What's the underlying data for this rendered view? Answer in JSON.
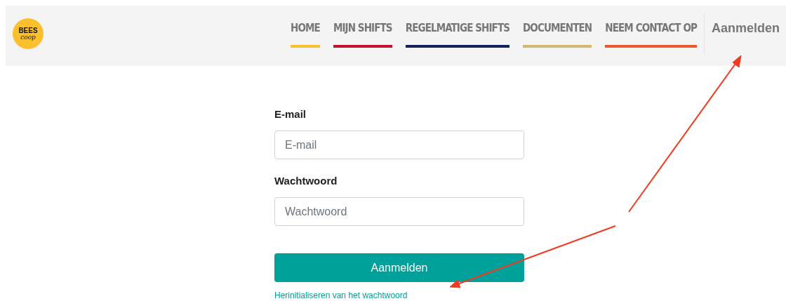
{
  "logo": {
    "line_1": "BEES",
    "line_2": "coop"
  },
  "nav": [
    {
      "label": "HOME",
      "color": "#fbc02d"
    },
    {
      "label": "MIJN SHIFTS",
      "color": "#c8102e"
    },
    {
      "label": "REGELMATIGE SHIFTS",
      "color": "#13235b"
    },
    {
      "label": "DOCUMENTEN",
      "color": "#d3b86f"
    },
    {
      "label": "NEEM CONTACT OP",
      "color": "#ea5a2d"
    }
  ],
  "login_link": "Aanmelden",
  "form": {
    "fields": [
      {
        "label": "E-mail",
        "placeholder": "E-mail"
      },
      {
        "label": "Wachtwoord",
        "placeholder": "Wachtwoord"
      }
    ],
    "submit": "Aanmelden",
    "reset_link": "Herinitialiseren van het wachtwoord"
  }
}
